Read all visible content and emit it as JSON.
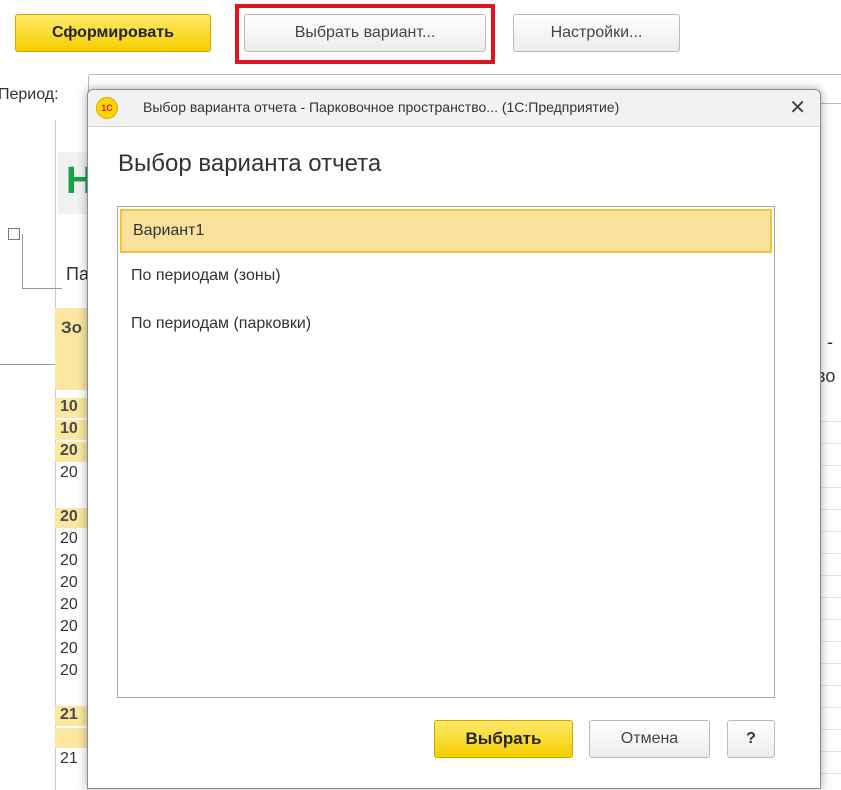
{
  "toolbar": {
    "generate_label": "Сформировать",
    "select_variant_label": "Выбрать вариант...",
    "settings_label": "Настройки..."
  },
  "background": {
    "period_label": "Период:",
    "report_title_fragment": "Н",
    "fragment_pa": "Па",
    "fragment_zo": "Зо",
    "fragment_right_1": ") -",
    "fragment_right_2": "во",
    "row_values": [
      "10",
      "10",
      "20",
      "20",
      "20",
      "20",
      "20",
      "20",
      "20",
      "20",
      "20",
      "20",
      "21",
      "21"
    ]
  },
  "dialog": {
    "title": "Выбор варианта отчета - Парковочное пространство... (1С:Предприятие)",
    "logo_text": "1С",
    "heading": "Выбор варианта отчета",
    "close_glyph": "✕",
    "items": [
      {
        "label": "Вариант1",
        "selected": true
      },
      {
        "label": "По периодам (зоны)",
        "selected": false
      },
      {
        "label": "По периодам (парковки)",
        "selected": false
      }
    ],
    "select_label": "Выбрать",
    "cancel_label": "Отмена",
    "help_label": "?"
  }
}
